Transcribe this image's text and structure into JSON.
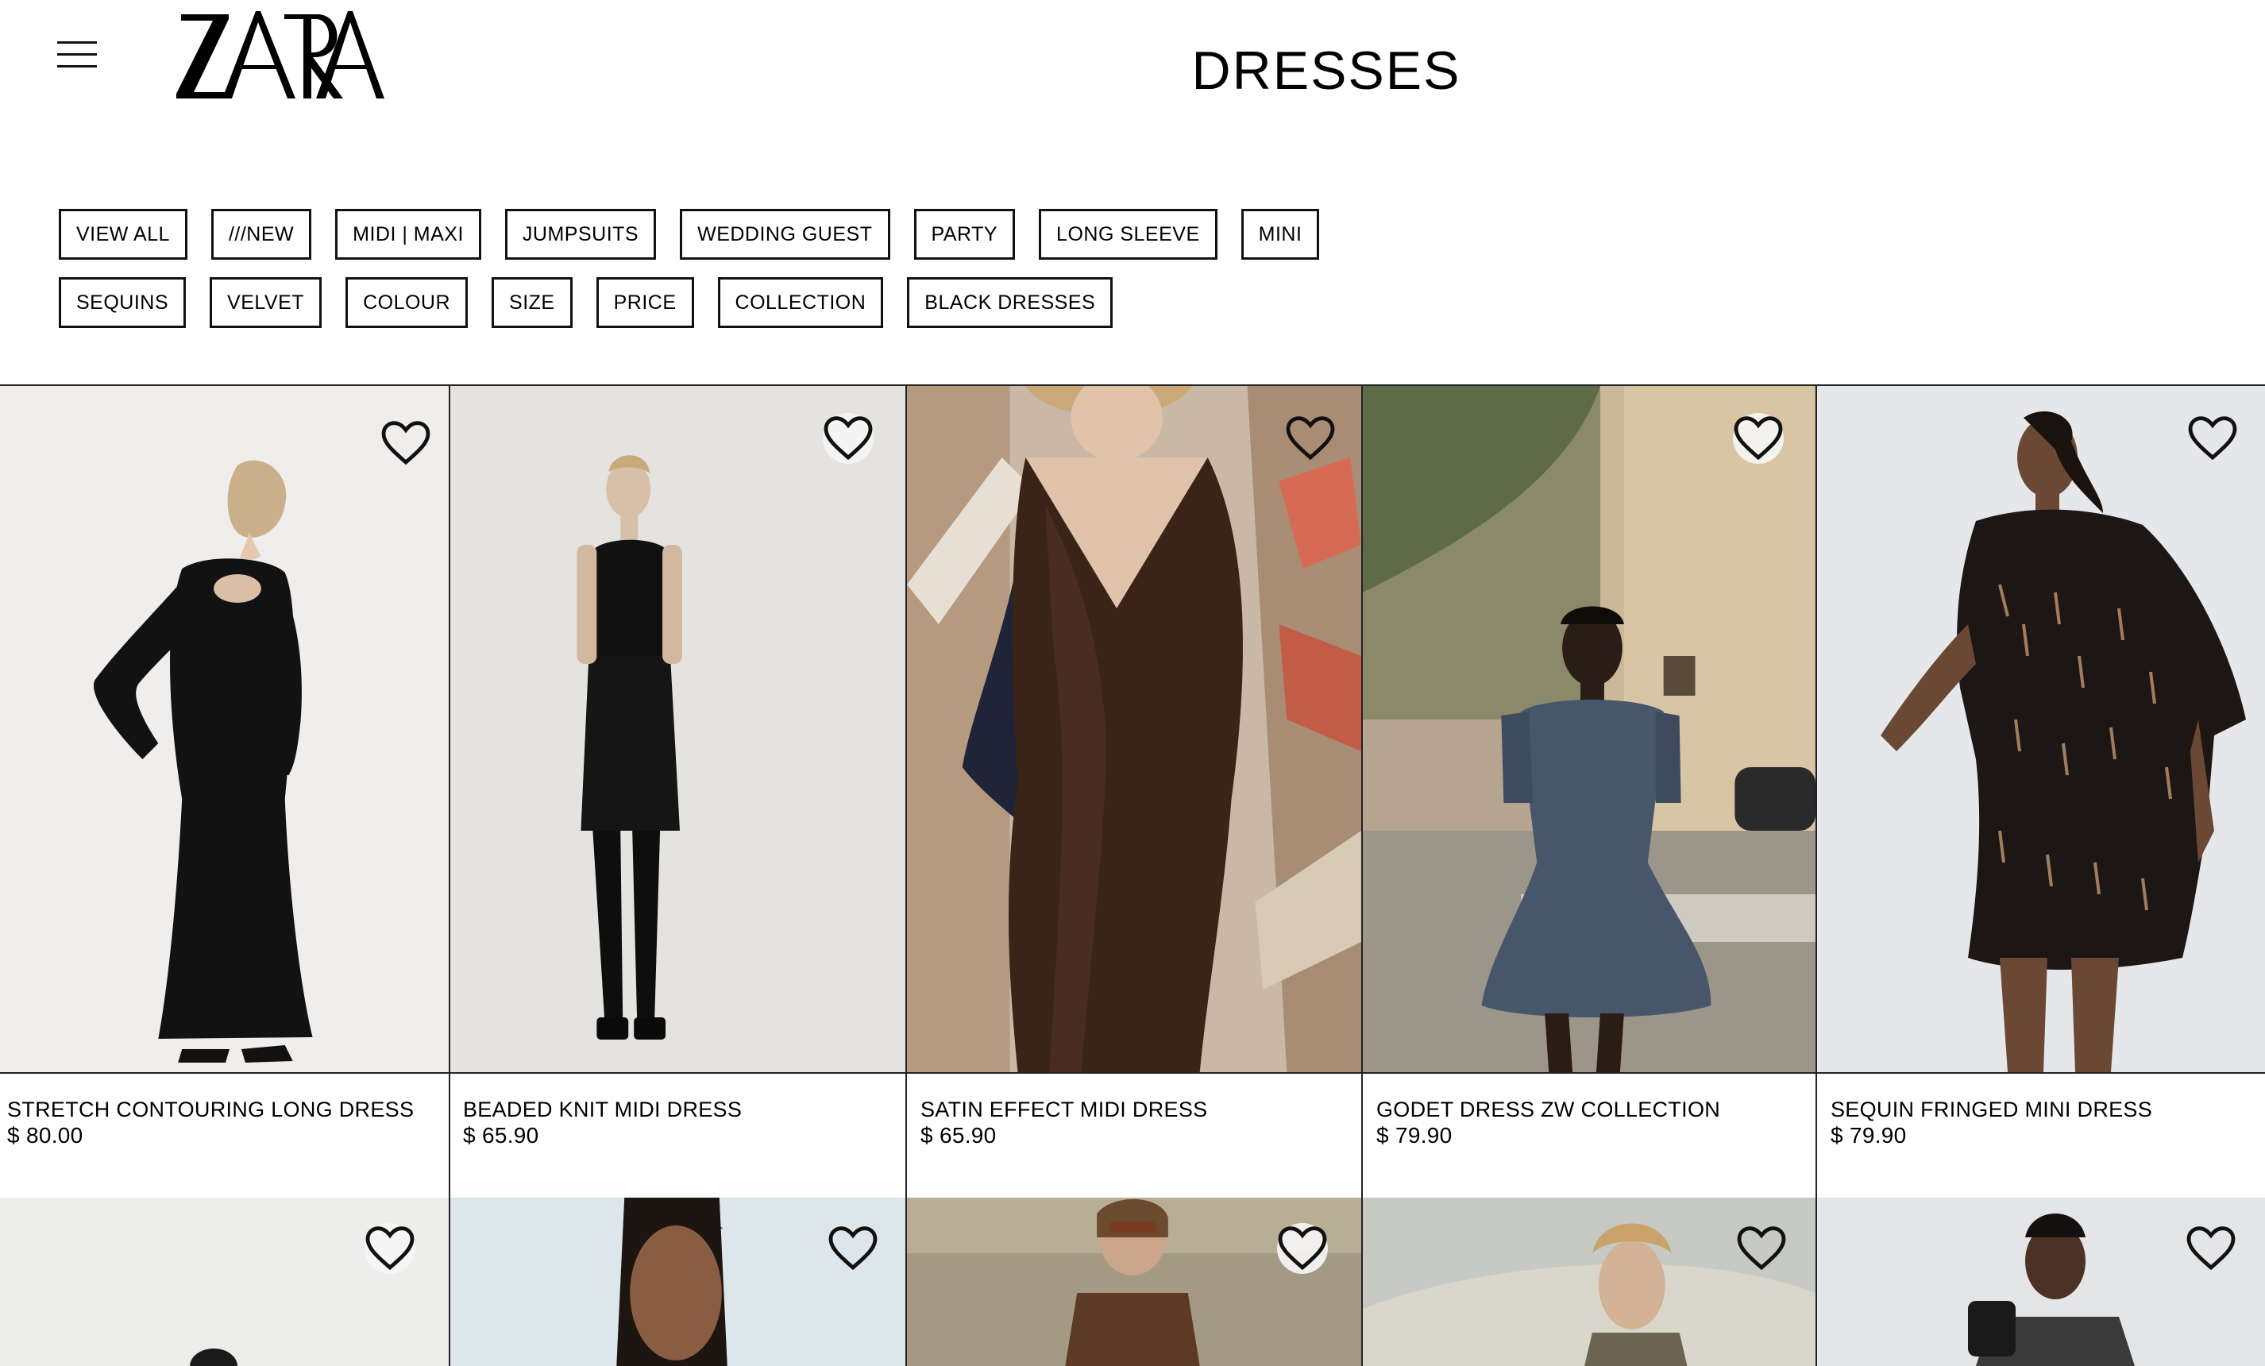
{
  "header": {
    "brand": "ZARA",
    "title": "DRESSES"
  },
  "filters": {
    "row1": [
      "VIEW ALL",
      "///NEW",
      "MIDI | MAXI",
      "JUMPSUITS",
      "WEDDING GUEST",
      "PARTY",
      "LONG SLEEVE",
      "MINI"
    ],
    "row2": [
      "SEQUINS",
      "VELVET",
      "COLOUR",
      "SIZE",
      "PRICE",
      "COLLECTION",
      "BLACK DRESSES"
    ]
  },
  "products": [
    {
      "name": "STRETCH CONTOURING LONG DRESS",
      "price": "$ 80.00"
    },
    {
      "name": "BEADED KNIT MIDI DRESS",
      "price": "$ 65.90"
    },
    {
      "name": "SATIN EFFECT MIDI DRESS",
      "price": "$ 65.90"
    },
    {
      "name": "GODET DRESS ZW COLLECTION",
      "price": "$ 79.90"
    },
    {
      "name": "SEQUIN FRINGED MINI DRESS",
      "price": "$ 79.90"
    }
  ],
  "icons": {
    "menu": "hamburger-menu-icon",
    "favorite": "heart-icon"
  },
  "colors": {
    "text": "#000000",
    "background": "#ffffff",
    "border": "#111111"
  }
}
